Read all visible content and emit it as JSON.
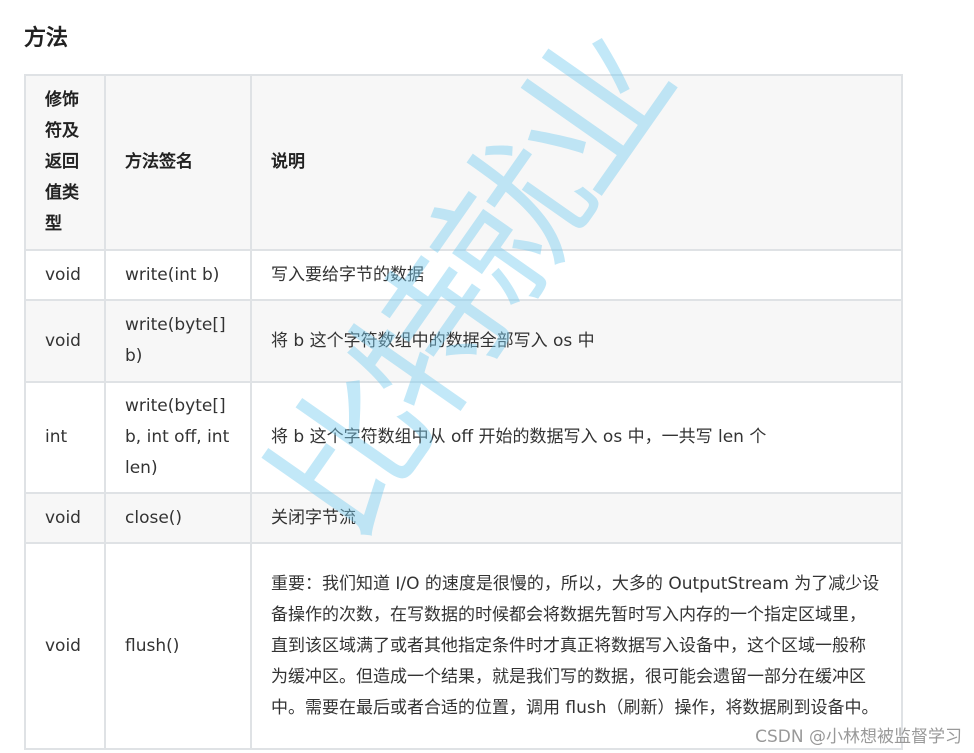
{
  "section_title": "方法",
  "table": {
    "headers": [
      "修饰符及返回值类型",
      "方法签名",
      "说明"
    ],
    "rows": [
      {
        "type": "void",
        "signature": "write(int b)",
        "desc": "写入要给字节的数据"
      },
      {
        "type": "void",
        "signature": "write(byte[] b)",
        "desc": "将 b 这个字符数组中的数据全部写入 os 中"
      },
      {
        "type": "int",
        "signature": "write(byte[] b, int off, int len)",
        "desc": "将 b 这个字符数组中从 off 开始的数据写入 os 中，一共写 len 个"
      },
      {
        "type": "void",
        "signature": "close()",
        "desc": "关闭字节流"
      },
      {
        "type": "void",
        "signature": "flush()",
        "desc": "重要：我们知道 I/O 的速度是很慢的，所以，大多的 OutputStream 为了减少设备操作的次数，在写数据的时候都会将数据先暂时写入内存的一个指定区域里，直到该区域满了或者其他指定条件时才真正将数据写入设备中，这个区域一般称为缓冲区。但造成一个结果，就是我们写的数据，很可能会遗留一部分在缓冲区中。需要在最后或者合适的位置，调用 flush（刷新）操作，将数据刷到设备中。"
      }
    ]
  },
  "watermark": "比特就业",
  "csdn_credit": "CSDN @小林想被监督学习"
}
